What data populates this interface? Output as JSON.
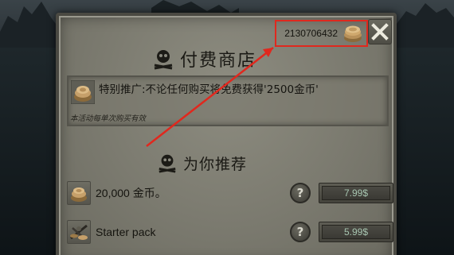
{
  "header": {
    "coins_value": "2130706432",
    "coin_icon": "coin-stack-icon",
    "close_icon": "close-x-icon"
  },
  "shop": {
    "title": "付费商店",
    "title_icon": "skull-crossbones-icon"
  },
  "promo": {
    "icon": "coin-bag-icon",
    "text": "特别推广:不论任何购买将免费获得'2500金币'",
    "note": "本活动每单次购买有效"
  },
  "recommend": {
    "title": "为你推荐",
    "title_icon": "skull-crossbones-icon"
  },
  "items": [
    {
      "name": "20,000 金币。",
      "icon": "coin-bag-icon",
      "help": "?",
      "price": "7.99$"
    },
    {
      "name": "Starter pack",
      "icon": "starter-pack-icon",
      "help": "?",
      "price": "5.99$"
    }
  ],
  "colors": {
    "panel": "#7b7a6f",
    "highlight_box": "#e0281e",
    "arrow": "#e0281e",
    "price_text": "#a7c5b0"
  }
}
